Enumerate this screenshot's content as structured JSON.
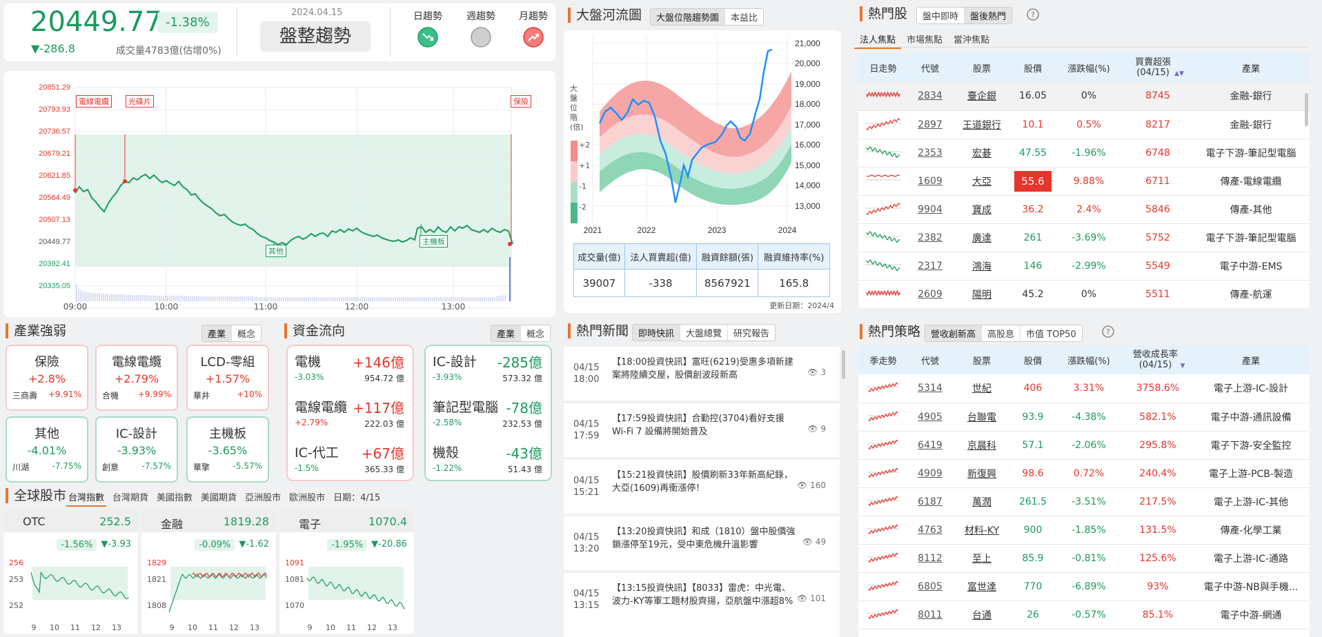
{
  "market": {
    "index": "20449.77",
    "pct": "-1.38%",
    "change": "▼-286.8",
    "volume": "成交量4783億(估增0%)",
    "date": "2024.04.15",
    "trend": "盤整趨勢",
    "trends": [
      {
        "label": "日趨勢",
        "state": "down"
      },
      {
        "label": "週趨勢",
        "state": "flat"
      },
      {
        "label": "月趨勢",
        "state": "up"
      }
    ]
  },
  "intraday": {
    "y_ticks": [
      "20851.29",
      "20793.93",
      "20736.57",
      "20679.21",
      "20621.85",
      "20564.49",
      "20507.13",
      "20449.77",
      "20392.41",
      "20335.05"
    ],
    "x_ticks": [
      "09:00",
      "10:00",
      "11:00",
      "12:00",
      "13:00"
    ],
    "annotations": [
      "電線電纜",
      "光碟片",
      "保險",
      "其他",
      "主機板"
    ]
  },
  "river": {
    "title": "大盤河流圖",
    "tabs": [
      "大盤位階趨勢圖",
      "本益比"
    ],
    "y_label": "大盤位階(倍)",
    "levels": [
      "+2",
      "+1",
      "-1",
      "-2"
    ],
    "y_ticks": [
      "21,000",
      "20,000",
      "19,000",
      "18,000",
      "17,000",
      "16,000",
      "15,000",
      "14,000",
      "13,000"
    ],
    "x_ticks": [
      "2021",
      "2022",
      "2023",
      "2024"
    ],
    "stats_head": [
      "成交量(億)",
      "法人買賣超(億)",
      "融資餘額(張)",
      "融資維持率(%)"
    ],
    "stats_vals": [
      "39007",
      "-338",
      "8567921",
      "165.8"
    ],
    "updated": "更新日期：2024/4"
  },
  "hot": {
    "title": "熱門股",
    "tabs": [
      "盤中即時",
      "盤後熱門"
    ],
    "subtabs": [
      "法人焦點",
      "市場焦點",
      "當沖焦點"
    ],
    "headers": [
      "日走勢",
      "代號",
      "股票",
      "股價",
      "漲跌幅(%)",
      "買賣超張(04/15)",
      "產業"
    ],
    "rows": [
      {
        "code": "2834",
        "name": "臺企銀",
        "price": "16.05",
        "pct": "0%",
        "vol": "8745",
        "ind": "金融-銀行",
        "c": "flat"
      },
      {
        "code": "2897",
        "name": "王道銀行",
        "price": "10.1",
        "pct": "0.5%",
        "vol": "8217",
        "ind": "金融-銀行",
        "c": "up"
      },
      {
        "code": "2353",
        "name": "宏碁",
        "price": "47.55",
        "pct": "-1.96%",
        "vol": "6748",
        "ind": "電子下游-筆記型電腦",
        "c": "down"
      },
      {
        "code": "1609",
        "name": "大亞",
        "price": "55.6",
        "pct": "9.88%",
        "vol": "6711",
        "ind": "傳產-電線電纜",
        "c": "limit"
      },
      {
        "code": "9904",
        "name": "寶成",
        "price": "36.2",
        "pct": "2.4%",
        "vol": "5846",
        "ind": "傳產-其他",
        "c": "up"
      },
      {
        "code": "2382",
        "name": "廣達",
        "price": "261",
        "pct": "-3.69%",
        "vol": "5752",
        "ind": "電子下游-筆記型電腦",
        "c": "down"
      },
      {
        "code": "2317",
        "name": "鴻海",
        "price": "146",
        "pct": "-2.99%",
        "vol": "5549",
        "ind": "電子中游-EMS",
        "c": "down"
      },
      {
        "code": "2609",
        "name": "陽明",
        "price": "45.2",
        "pct": "0%",
        "vol": "5511",
        "ind": "傳產-航運",
        "c": "flat"
      }
    ]
  },
  "strategy": {
    "title": "熱門策略",
    "tabs": [
      "營收創新高",
      "高股息",
      "市值 TOP50"
    ],
    "headers": [
      "季走勢",
      "代號",
      "股票",
      "股價",
      "漲跌幅(%)",
      "營收成長率(04/15)",
      "產業"
    ],
    "rows": [
      {
        "code": "5314",
        "name": "世紀",
        "price": "406",
        "pct": "3.31%",
        "g": "3758.6%",
        "ind": "電子上游-IC-設計",
        "c": "up"
      },
      {
        "code": "4905",
        "name": "台聯電",
        "price": "93.9",
        "pct": "-4.38%",
        "g": "582.1%",
        "ind": "電子中游-通訊設備",
        "c": "down"
      },
      {
        "code": "6419",
        "name": "京晨科",
        "price": "57.1",
        "pct": "-2.06%",
        "g": "295.8%",
        "ind": "電子下游-安全監控",
        "c": "down"
      },
      {
        "code": "4909",
        "name": "新復興",
        "price": "98.6",
        "pct": "0.72%",
        "g": "240.4%",
        "ind": "電子上游-PCB-製造",
        "c": "up"
      },
      {
        "code": "6187",
        "name": "萬潤",
        "price": "261.5",
        "pct": "-3.51%",
        "g": "217.5%",
        "ind": "電子上游-IC-其他",
        "c": "down"
      },
      {
        "code": "4763",
        "name": "材料-KY",
        "price": "900",
        "pct": "-1.85%",
        "g": "131.5%",
        "ind": "傳產-化學工業",
        "c": "down"
      },
      {
        "code": "8112",
        "name": "至上",
        "price": "85.9",
        "pct": "-0.81%",
        "g": "125.6%",
        "ind": "電子上游-IC-通路",
        "c": "down"
      },
      {
        "code": "6805",
        "name": "富世達",
        "price": "770",
        "pct": "-6.89%",
        "g": "93%",
        "ind": "電子中游-NB與手機...",
        "c": "down"
      },
      {
        "code": "8011",
        "name": "台通",
        "price": "26",
        "pct": "-0.57%",
        "g": "85.1%",
        "ind": "電子中游-網通",
        "c": "down"
      }
    ]
  },
  "industry": {
    "title": "產業強弱",
    "tabs": [
      "產業",
      "概念"
    ],
    "cards": [
      {
        "name": "保險",
        "pct": "+2.8%",
        "sub": "三商壽",
        "subpct": "+9.91%",
        "c": "r"
      },
      {
        "name": "電線電纜",
        "pct": "+2.79%",
        "sub": "合機",
        "subpct": "+9.99%",
        "c": "r"
      },
      {
        "name": "LCD-零組",
        "pct": "+1.57%",
        "sub": "華井",
        "subpct": "+10%",
        "c": "r"
      },
      {
        "name": "其他",
        "pct": "-4.01%",
        "sub": "川湖",
        "subpct": "-7.75%",
        "c": "g"
      },
      {
        "name": "IC-設計",
        "pct": "-3.93%",
        "sub": "創意",
        "subpct": "-7.57%",
        "c": "g"
      },
      {
        "name": "主機板",
        "pct": "-3.65%",
        "sub": "華擎",
        "subpct": "-5.57%",
        "c": "g"
      }
    ]
  },
  "flow": {
    "title": "資金流向",
    "tabs": [
      "產業",
      "概念"
    ],
    "inflow": [
      {
        "name": "電機",
        "amt": "+146億",
        "pct": "-3.03%",
        "vol": "954.72 億"
      },
      {
        "name": "電線電纜",
        "amt": "+117億",
        "pct": "+2.79%",
        "vol": "222.03 億"
      },
      {
        "name": "IC-代工",
        "amt": "+67億",
        "pct": "-1.5%",
        "vol": "365.33 億"
      }
    ],
    "outflow": [
      {
        "name": "IC-設計",
        "amt": "-285億",
        "pct": "-3.93%",
        "vol": "573.32 億"
      },
      {
        "name": "筆記型電腦",
        "amt": "-78億",
        "pct": "-2.58%",
        "vol": "232.53 億"
      },
      {
        "name": "機殼",
        "amt": "-43億",
        "pct": "-1.22%",
        "vol": "51.43 億"
      }
    ]
  },
  "global": {
    "title": "全球股市",
    "tabs": [
      "台灣指數",
      "台灣期貨",
      "美國指數",
      "美國期貨",
      "亞洲股市",
      "歐洲股市"
    ],
    "date": "日期：4/15",
    "cards": [
      {
        "name": "OTC",
        "val": "252.5",
        "pct": "-1.56%",
        "chg": "▼-3.93",
        "y": [
          "256",
          "253",
          "252"
        ],
        "x": [
          "9",
          "10",
          "11",
          "12",
          "13"
        ]
      },
      {
        "name": "金融",
        "val": "1819.28",
        "pct": "-0.09%",
        "chg": "▼-1.62",
        "y": [
          "1829",
          "1821",
          "1808"
        ],
        "x": [
          "9",
          "10",
          "11",
          "12",
          "13"
        ]
      },
      {
        "name": "電子",
        "val": "1070.4",
        "pct": "-1.95%",
        "chg": "▼-20.86",
        "y": [
          "1091",
          "1081",
          "1070"
        ],
        "x": [
          "9",
          "10",
          "11",
          "12",
          "13"
        ]
      }
    ]
  },
  "news": {
    "title": "熱門新聞",
    "tabs": [
      "即時快訊",
      "大盤總覽",
      "研究報告"
    ],
    "items": [
      {
        "date": "04/15",
        "time": "18:00",
        "text": "【18:00投資快訊】富旺(6219)受惠多項新建案將陸續交屋，股價創波段新高",
        "views": "3"
      },
      {
        "date": "04/15",
        "time": "17:59",
        "text": "【17:59投資快訊】合勤控(3704)看好支援 Wi-Fi 7 設備將開始普及",
        "views": "9"
      },
      {
        "date": "04/15",
        "time": "15:21",
        "text": "【15:21投資快訊】股價刷新33年新高紀錄，大亞(1609)再衝漲停！",
        "views": "160"
      },
      {
        "date": "04/15",
        "time": "13:20",
        "text": "【13:20投資快訊】和成（1810）盤中股價強鎖漲停至19元，受中東危機升溫影響",
        "views": "49"
      },
      {
        "date": "04/15",
        "time": "13:15",
        "text": "【13:15投資快訊】【8033】雷虎：中光電、波力-KY等軍工題材股齊揚，亞航盤中漲超8%",
        "views": "101"
      }
    ]
  }
}
